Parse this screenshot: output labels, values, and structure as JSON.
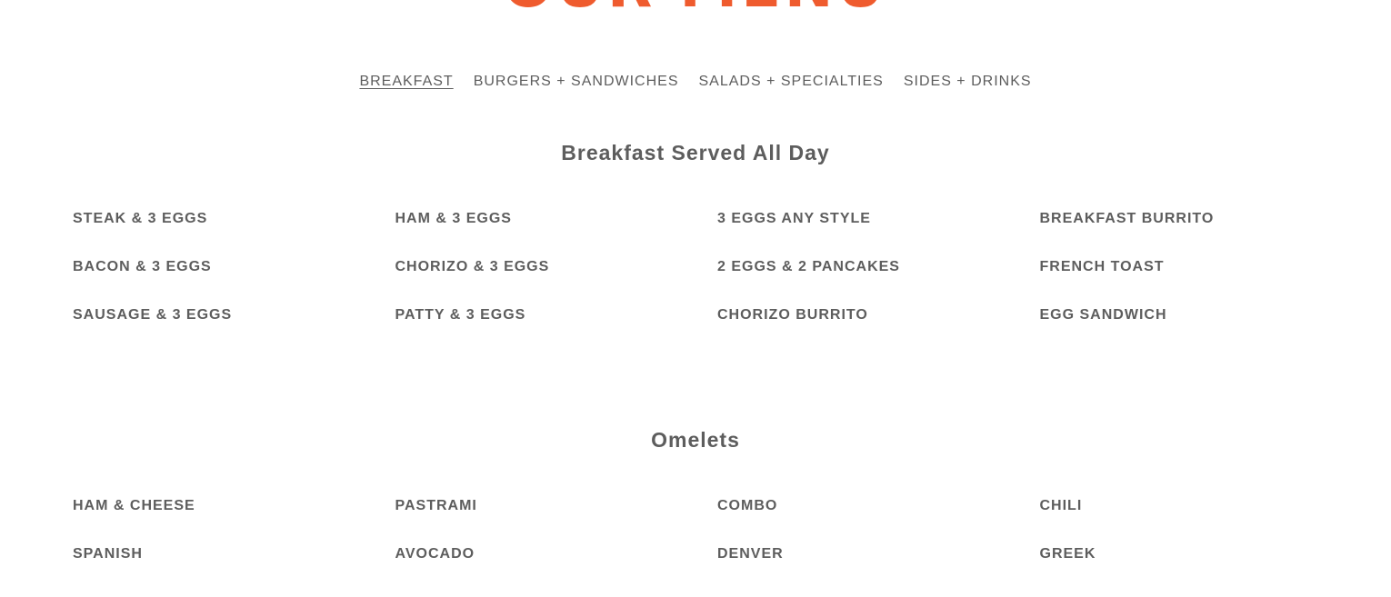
{
  "brand": {
    "title": "OUR MENU",
    "accent_color": "#ef5b2e",
    "text_color": "#5d5d5d"
  },
  "tabs": [
    {
      "label": "BREAKFAST",
      "active": true
    },
    {
      "label": "BURGERS + SANDWICHES",
      "active": false
    },
    {
      "label": "SALADS + SPECIALTIES",
      "active": false
    },
    {
      "label": "SIDES + DRINKS",
      "active": false
    }
  ],
  "sections": [
    {
      "heading": "Breakfast Served All Day",
      "items": [
        "STEAK & 3 EGGS",
        "HAM & 3 EGGS",
        "3 EGGS ANY STYLE",
        "BREAKFAST BURRITO",
        "BACON & 3 EGGS",
        "CHORIZO & 3 EGGS",
        "2 EGGS & 2 PANCAKES",
        "FRENCH TOAST",
        "SAUSAGE & 3 EGGS",
        "PATTY & 3 EGGS",
        "CHORIZO BURRITO",
        "EGG SANDWICH"
      ]
    },
    {
      "heading": "Omelets",
      "items": [
        "HAM & CHEESE",
        "PASTRAMI",
        "COMBO",
        "CHILI",
        "SPANISH",
        "AVOCADO",
        "DENVER",
        "GREEK"
      ]
    }
  ]
}
